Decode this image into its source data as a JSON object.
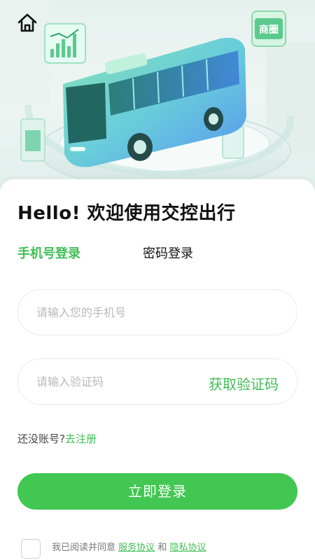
{
  "header": {
    "home_icon": "home-icon"
  },
  "hero": {
    "sign_text": "商圈"
  },
  "welcome": "Hello! 欢迎使用交控出行",
  "tabs": {
    "phone_login": "手机号登录",
    "password_login": "密码登录"
  },
  "phone": {
    "placeholder": "请输入您的手机号",
    "value": ""
  },
  "code": {
    "placeholder": "请输入验证码",
    "value": "",
    "get_code": "获取验证码"
  },
  "register": {
    "prompt": "还没账号?",
    "link": "去注册"
  },
  "login_button": "立即登录",
  "agreement": {
    "prefix": "我已阅读并同意",
    "service": "服务协议",
    "and": "和",
    "privacy": "隐私协议",
    "checked": false
  },
  "colors": {
    "accent": "#41c752",
    "text": "#111111",
    "placeholder": "#b9b9b9"
  }
}
